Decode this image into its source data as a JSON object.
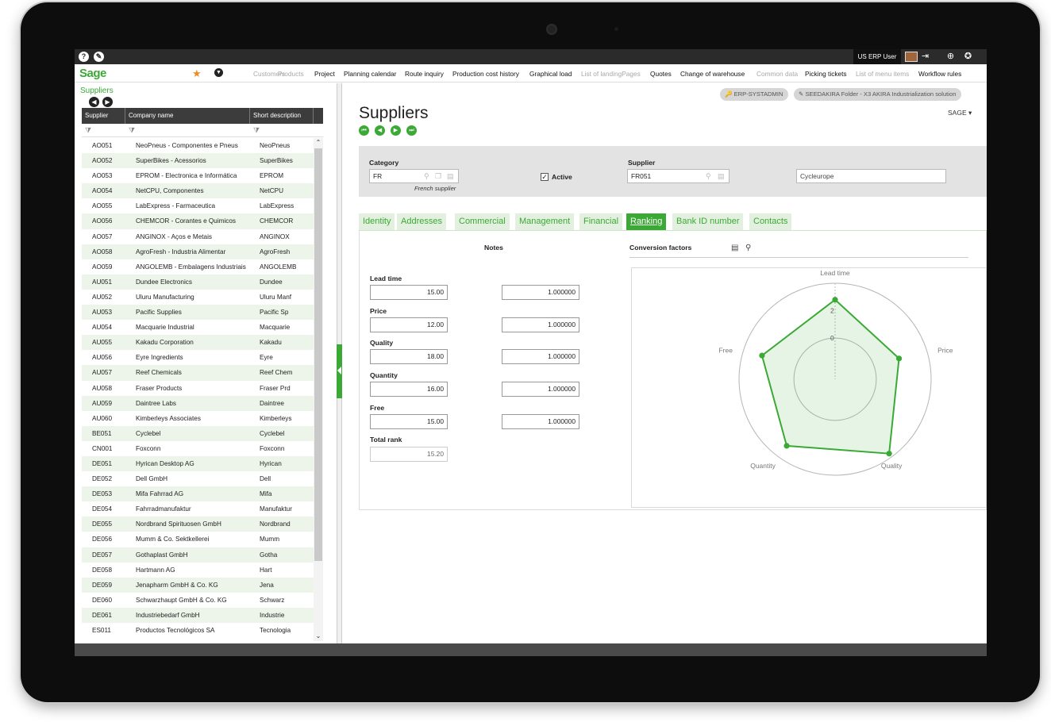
{
  "topbar": {
    "help_icon": "question-icon",
    "settings_icon": "wrench-icon",
    "user": "US ERP User",
    "icons": [
      "logout-icon",
      "globe-icon",
      "help-circle-icon"
    ]
  },
  "menubar": {
    "logo": "Sage",
    "items": [
      {
        "label": "Customers",
        "dim": true
      },
      {
        "label": "Products",
        "dim": true
      },
      {
        "label": "Project",
        "dim": false
      },
      {
        "label": "Planning calendar",
        "dim": false
      },
      {
        "label": "Route inquiry",
        "dim": false
      },
      {
        "label": "Production cost history",
        "dim": false
      },
      {
        "label": "Graphical load",
        "dim": false
      },
      {
        "label": "List of landingPages",
        "dim": true
      },
      {
        "label": "Quotes",
        "dim": false
      },
      {
        "label": "Change of warehouse",
        "dim": false
      },
      {
        "label": "Common data",
        "dim": true
      },
      {
        "label": "Picking tickets",
        "dim": false
      },
      {
        "label": "List of menu items",
        "dim": true
      },
      {
        "label": "Workflow rules",
        "dim": false
      }
    ]
  },
  "list": {
    "title": "Suppliers",
    "columns": [
      "Supplier",
      "Company name",
      "Short description"
    ],
    "rows": [
      [
        "AO051",
        "NeoPneus - Componentes e Pneus",
        "NeoPneus"
      ],
      [
        "AO052",
        "SuperBikes - Acessorios",
        "SuperBikes"
      ],
      [
        "AO053",
        "EPROM - Electronica e Informática",
        "EPROM"
      ],
      [
        "AO054",
        "NetCPU, Componentes",
        "NetCPU"
      ],
      [
        "AO055",
        "LabExpress - Farmaceutica",
        "LabExpress"
      ],
      [
        "AO056",
        "CHEMCOR - Corantes e Quimicos",
        "CHEMCOR"
      ],
      [
        "AO057",
        "ANGINOX - Aços e Metais",
        "ANGINOX"
      ],
      [
        "AO058",
        "AgroFresh - Industria Alimentar",
        "AgroFresh"
      ],
      [
        "AO059",
        "ANGOLEMB - Embalagens Industriais",
        "ANGOLEMB"
      ],
      [
        "AU051",
        "Dundee Electronics",
        "Dundee"
      ],
      [
        "AU052",
        "Uluru Manufacturing",
        "Uluru Manf"
      ],
      [
        "AU053",
        "Pacific Supplies",
        "Pacific Sp"
      ],
      [
        "AU054",
        "Macquarie Industrial",
        "Macquarie"
      ],
      [
        "AU055",
        "Kakadu Corporation",
        "Kakadu"
      ],
      [
        "AU056",
        "Eyre Ingredients",
        "Eyre"
      ],
      [
        "AU057",
        "Reef Chemicals",
        "Reef Chem"
      ],
      [
        "AU058",
        "Fraser Products",
        "Fraser Prd"
      ],
      [
        "AU059",
        "Daintree Labs",
        "Daintree"
      ],
      [
        "AU060",
        "Kimberleys Associates",
        "Kimberleys"
      ],
      [
        "BE051",
        "Cyclebel",
        "Cyclebel"
      ],
      [
        "CN001",
        "Foxconn",
        "Foxconn"
      ],
      [
        "DE051",
        "Hyrican Desktop AG",
        "Hyrican"
      ],
      [
        "DE052",
        "Dell GmbH",
        "Dell"
      ],
      [
        "DE053",
        "Mifa Fahrrad AG",
        "Mifa"
      ],
      [
        "DE054",
        "Fahrradmanufaktur",
        "Manufaktur"
      ],
      [
        "DE055",
        "Nordbrand Spirituosen GmbH",
        "Nordbrand"
      ],
      [
        "DE056",
        "Mumm & Co. Sektkellerei",
        "Mumm"
      ],
      [
        "DE057",
        "Gothaplast GmbH",
        "Gotha"
      ],
      [
        "DE058",
        "Hartmann AG",
        "Hart"
      ],
      [
        "DE059",
        "Jenapharm GmbH & Co. KG",
        "Jena"
      ],
      [
        "DE060",
        "Schwarzhaupt GmbH & Co. KG",
        "Schwarz"
      ],
      [
        "DE061",
        "Industriebedarf GmbH",
        "Industrie"
      ],
      [
        "ES011",
        "Productos Tecnológicos SA",
        "Tecnologia"
      ]
    ]
  },
  "header": {
    "badge1": "ERP-SYSTADMIN",
    "badge2": "SEEDAKIRA Folder - X3 AKIRA Industrialization solution",
    "title": "Suppliers",
    "folder": "SAGE"
  },
  "form": {
    "category_label": "Category",
    "category_value": "FR",
    "category_desc": "French supplier",
    "active_label": "Active",
    "active_checked": true,
    "supplier_label": "Supplier",
    "supplier_value": "FR051",
    "supplier_name": "Cycleurope"
  },
  "tabs": [
    "Identity",
    "Addresses",
    "Commercial",
    "Management",
    "Financial",
    "Ranking",
    "Bank ID number",
    "Contacts"
  ],
  "active_tab": "Ranking",
  "ranking": {
    "notes_label": "Notes",
    "conversion_label": "Conversion factors",
    "criteria": [
      {
        "label": "Lead time",
        "note": "15.00",
        "factor": "1.000000"
      },
      {
        "label": "Price",
        "note": "12.00",
        "factor": "1.000000"
      },
      {
        "label": "Quality",
        "note": "18.00",
        "factor": "1.000000"
      },
      {
        "label": "Quantity",
        "note": "16.00",
        "factor": "1.000000"
      },
      {
        "label": "Free",
        "note": "15.00",
        "factor": "1.000000"
      }
    ],
    "total_label": "Total rank",
    "total_value": "15.20"
  },
  "chart_data": {
    "type": "radar",
    "categories": [
      "Lead time",
      "Price",
      "Quality",
      "Quantity",
      "Free"
    ],
    "values": [
      2.8,
      1.9,
      3.7,
      3.0,
      2.6
    ],
    "scale_labels": [
      "0",
      "2"
    ],
    "rlim": [
      -3,
      4
    ],
    "fill_color": "#3ba935"
  },
  "colors": {
    "accent": "#3ba935"
  }
}
